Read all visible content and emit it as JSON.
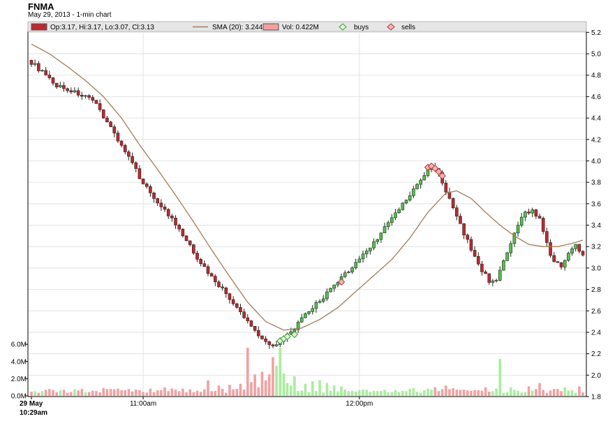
{
  "chart_data": {
    "type": "candlestick",
    "title": "FNMA",
    "subtitle": "May 29, 2013 - 1-min chart",
    "legend": {
      "ohlc": "Op:3.17, Hi:3.17, Lo:3.07, Cl:3.13",
      "sma": "SMA (20): 3.244",
      "vol": "Vol: 0.422M",
      "buys": "buys",
      "sells": "sells"
    },
    "x_ticks": [
      {
        "minute": 0,
        "label": "29 May",
        "label2": "10:29am"
      },
      {
        "minute": 31,
        "label": "11:00am"
      },
      {
        "minute": 91,
        "label": "12:00pm"
      }
    ],
    "x_range_minutes": [
      0,
      153
    ],
    "price_axis": {
      "range": [
        1.8,
        5.3
      ],
      "ticks": [
        "1.8",
        "2.0",
        "2.2",
        "2.4",
        "2.6",
        "2.8",
        "3.0",
        "3.2",
        "3.4",
        "3.6",
        "3.8",
        "4.0",
        "4.2",
        "4.4",
        "4.6",
        "4.8",
        "5.0",
        "5.2"
      ]
    },
    "volume_axis": {
      "range": [
        0,
        6.5
      ],
      "ticks": [
        "0.0M",
        "2.0M",
        "4.0M",
        "6.0M"
      ]
    },
    "price_anchors": [
      [
        0,
        4.92
      ],
      [
        3,
        4.83
      ],
      [
        6,
        4.72
      ],
      [
        9,
        4.68
      ],
      [
        12,
        4.64
      ],
      [
        15,
        4.6
      ],
      [
        18,
        4.52
      ],
      [
        21,
        4.37
      ],
      [
        24,
        4.2
      ],
      [
        27,
        4.03
      ],
      [
        30,
        3.85
      ],
      [
        33,
        3.7
      ],
      [
        36,
        3.58
      ],
      [
        39,
        3.45
      ],
      [
        42,
        3.3
      ],
      [
        45,
        3.15
      ],
      [
        48,
        3.0
      ],
      [
        51,
        2.88
      ],
      [
        54,
        2.76
      ],
      [
        57,
        2.62
      ],
      [
        60,
        2.5
      ],
      [
        63,
        2.38
      ],
      [
        66,
        2.28
      ],
      [
        69,
        2.31
      ],
      [
        72,
        2.4
      ],
      [
        75,
        2.52
      ],
      [
        78,
        2.63
      ],
      [
        81,
        2.73
      ],
      [
        84,
        2.83
      ],
      [
        87,
        2.94
      ],
      [
        90,
        3.05
      ],
      [
        93,
        3.16
      ],
      [
        96,
        3.28
      ],
      [
        99,
        3.42
      ],
      [
        102,
        3.55
      ],
      [
        105,
        3.68
      ],
      [
        108,
        3.82
      ],
      [
        110,
        3.92
      ],
      [
        112,
        3.95
      ],
      [
        113,
        3.88
      ],
      [
        115,
        3.72
      ],
      [
        117,
        3.55
      ],
      [
        119,
        3.4
      ],
      [
        121,
        3.25
      ],
      [
        123,
        3.1
      ],
      [
        125,
        2.98
      ],
      [
        127,
        2.88
      ],
      [
        129,
        2.9
      ],
      [
        131,
        3.05
      ],
      [
        133,
        3.22
      ],
      [
        135,
        3.4
      ],
      [
        137,
        3.52
      ],
      [
        139,
        3.54
      ],
      [
        141,
        3.45
      ],
      [
        143,
        3.22
      ],
      [
        145,
        3.05
      ],
      [
        147,
        3.02
      ],
      [
        149,
        3.15
      ],
      [
        151,
        3.21
      ],
      [
        153,
        3.13
      ]
    ],
    "sma_anchors": [
      [
        0,
        5.09
      ],
      [
        5,
        5.0
      ],
      [
        10,
        4.88
      ],
      [
        15,
        4.75
      ],
      [
        20,
        4.6
      ],
      [
        25,
        4.4
      ],
      [
        30,
        4.15
      ],
      [
        35,
        3.92
      ],
      [
        40,
        3.68
      ],
      [
        45,
        3.43
      ],
      [
        50,
        3.17
      ],
      [
        55,
        2.92
      ],
      [
        60,
        2.68
      ],
      [
        65,
        2.5
      ],
      [
        70,
        2.42
      ],
      [
        75,
        2.44
      ],
      [
        80,
        2.52
      ],
      [
        85,
        2.63
      ],
      [
        90,
        2.78
      ],
      [
        95,
        2.93
      ],
      [
        100,
        3.08
      ],
      [
        105,
        3.28
      ],
      [
        110,
        3.52
      ],
      [
        115,
        3.7
      ],
      [
        118,
        3.72
      ],
      [
        122,
        3.65
      ],
      [
        126,
        3.52
      ],
      [
        130,
        3.4
      ],
      [
        134,
        3.3
      ],
      [
        138,
        3.22
      ],
      [
        142,
        3.2
      ],
      [
        146,
        3.2
      ],
      [
        150,
        3.23
      ],
      [
        153,
        3.26
      ]
    ],
    "volume_spikes": [
      [
        20,
        0.9
      ],
      [
        37,
        1.0
      ],
      [
        49,
        1.8
      ],
      [
        52,
        1.2
      ],
      [
        55,
        1.3
      ],
      [
        58,
        1.4
      ],
      [
        60,
        5.6
      ],
      [
        61,
        1.6
      ],
      [
        62,
        2.5
      ],
      [
        63,
        1.0
      ],
      [
        64,
        2.8
      ],
      [
        65,
        1.8
      ],
      [
        66,
        2.5
      ],
      [
        67,
        4.5
      ],
      [
        68,
        3.5
      ],
      [
        69,
        5.6
      ],
      [
        70,
        2.6
      ],
      [
        71,
        1.5
      ],
      [
        72,
        1.2
      ],
      [
        73,
        2.3
      ],
      [
        76,
        1.4
      ],
      [
        78,
        1.7
      ],
      [
        80,
        1.8
      ],
      [
        82,
        1.5
      ],
      [
        84,
        1.2
      ],
      [
        86,
        1.1
      ],
      [
        106,
        0.9
      ],
      [
        112,
        1.0
      ],
      [
        115,
        1.2
      ],
      [
        117,
        0.9
      ],
      [
        126,
        1.0
      ],
      [
        130,
        4.3
      ],
      [
        133,
        1.0
      ],
      [
        138,
        1.1
      ],
      [
        141,
        1.5
      ],
      [
        148,
        1.0
      ],
      [
        152,
        1.1
      ]
    ],
    "buy_markers": [
      [
        69,
        2.32
      ],
      [
        70,
        2.34
      ],
      [
        71,
        2.36
      ],
      [
        73,
        2.38
      ]
    ],
    "sell_markers": [
      [
        86,
        2.87
      ],
      [
        110,
        3.94
      ],
      [
        111,
        3.95
      ],
      [
        112,
        3.93
      ],
      [
        113,
        3.9
      ],
      [
        114,
        3.86
      ]
    ],
    "colors": {
      "up": "#4fc34a",
      "down": "#c0282d",
      "up_vol": "#a8ee9c",
      "down_vol": "#f3a0a0",
      "sma": "#a57a55",
      "grid": "#e2e2e2",
      "legend_bg": "#e6e6e6"
    }
  }
}
